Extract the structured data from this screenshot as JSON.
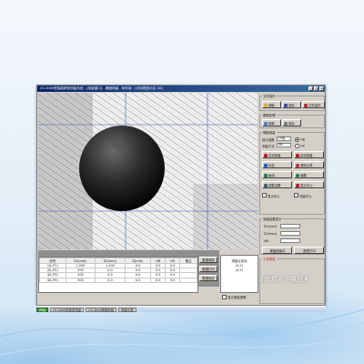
{
  "window": {
    "title": "CS-3000型智能精密测量系统 - [测量窗口] - 硬度测量 - 软件版 - [对话框显示区 2D]",
    "controls": [
      "_",
      "□",
      "×"
    ]
  },
  "viewport": {
    "image_description_icon": "indentation-image"
  },
  "table": {
    "headers": [
      "序号",
      "D1(mm)",
      "D2(mm)",
      "D(mm)",
      "HB",
      "HV",
      "备注"
    ],
    "rows": [
      [
        "1(L,P1)",
        "1.200",
        "1.200",
        "0.0",
        "0.0",
        "0.0",
        ""
      ],
      [
        "2(L,P2)",
        "200",
        "0.0",
        "0.0",
        "0.0",
        "0.0",
        ""
      ],
      [
        "3(L,P3)",
        "200",
        "0.0",
        "0.0",
        "0.0",
        "0.0",
        ""
      ],
      [
        "4(L,P4)",
        "200",
        "0.0",
        "0.0",
        "0.0",
        "0.0",
        ""
      ]
    ]
  },
  "mid_buttons": [
    "数据清除",
    "数据打印",
    "数据保存"
  ],
  "coord_box": {
    "title": "测量点坐标",
    "line1": "(X,Y)",
    "line2": "(X,Y)"
  },
  "show_crosshair_label": "显示测量视野",
  "panel": {
    "file_ops": {
      "title": "文件操作",
      "open": "读取",
      "save": "保存",
      "file_save": "文件保存"
    },
    "image_ops": {
      "title": "图像处理",
      "btn1": "刷新",
      "btn2": "保存"
    },
    "measure": {
      "title": "硬度测量",
      "magnif_label": "放大倍数",
      "magnif_value": "10倍",
      "method_label": "测量方式",
      "method_value": "HB",
      "radio_a": "HB",
      "radio_b": "HV",
      "btn_manual": "手动测量",
      "btn_auto": "自动测量",
      "btn_cal": "标定",
      "btn_clear": "清除记录",
      "btn_line": "画线",
      "btn_circle": "画圆",
      "btn_para": "参数设置",
      "btn_center": "显示中心",
      "chk1": "显示中心",
      "chk2": "测量中心"
    },
    "results": {
      "title": "测量结果显示",
      "r1_label": "D1(mm)",
      "r1_value": "",
      "r2_label": "D2(mm)",
      "r2_value": "",
      "hb_label": "HB",
      "hb_value": "",
      "btn_save": "硬度值保存",
      "btn_print": "报表打印"
    },
    "status": {
      "title": "工作状态"
    }
  },
  "taskbar": {
    "items": [
      "开始",
      "CS-3000型精密测量",
      "CS-3000精度测量",
      "测量记录"
    ]
  },
  "watermark": "湖南精密测量技术"
}
